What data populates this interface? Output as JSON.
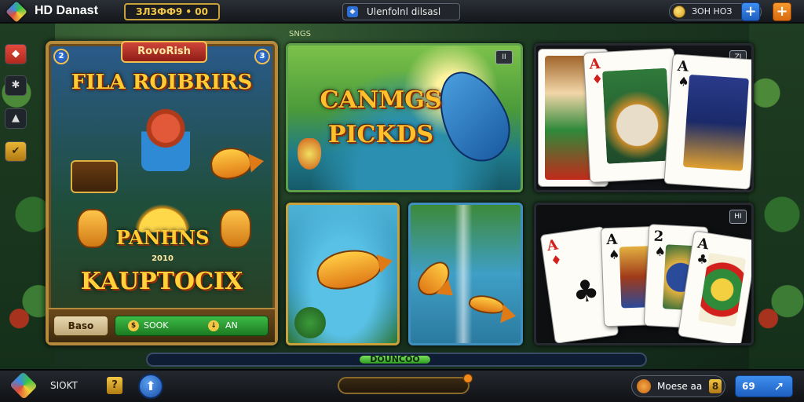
{
  "topbar": {
    "title": "HD Danast",
    "coins": "ЗЛЗФФ9 • 00",
    "mode_label": "Ulenfolnl dilsasl",
    "balance": "ЗОН НОЗ"
  },
  "sidebar": {
    "items": [
      {
        "icon": "tag-icon"
      },
      {
        "icon": "puzzle-icon"
      },
      {
        "icon": "thumb-icon"
      },
      {
        "icon": "check-icon"
      }
    ]
  },
  "featured": {
    "badge": "RovoRish",
    "left_corner": "2",
    "right_corner": "3",
    "title": "FILA ROIBRIRS",
    "subtitle": "PANHNS",
    "year": "2010",
    "main": "KAUPTOCIX",
    "cancel_label": "Baso",
    "book_label": "SOOK",
    "book_value": "AN"
  },
  "section_label": "SNGS",
  "tiles": {
    "fish_main": {
      "line1": "CANMGS",
      "line2": "PICKDS",
      "badge": "II"
    },
    "cards_a": {
      "badge": "ZI",
      "cards": [
        {
          "rank": "A",
          "suit": "♦",
          "red": true
        },
        {
          "rank": "A",
          "suit": "♠",
          "red": false
        }
      ]
    },
    "cards_b": {
      "badge": "HI",
      "cards": [
        {
          "rank": "A",
          "suit": "♦",
          "red": true
        },
        {
          "rank": "A",
          "suit": "♠",
          "red": false
        },
        {
          "rank": "2",
          "suit": "♠",
          "red": false
        },
        {
          "rank": "A",
          "suit": "♣",
          "red": false
        }
      ]
    }
  },
  "bottombar": {
    "progress_label": "DOUNCOO",
    "user": "SIOKT",
    "help": "?",
    "mode": "Moese aa",
    "mode_num": "8",
    "right_label": "69"
  }
}
